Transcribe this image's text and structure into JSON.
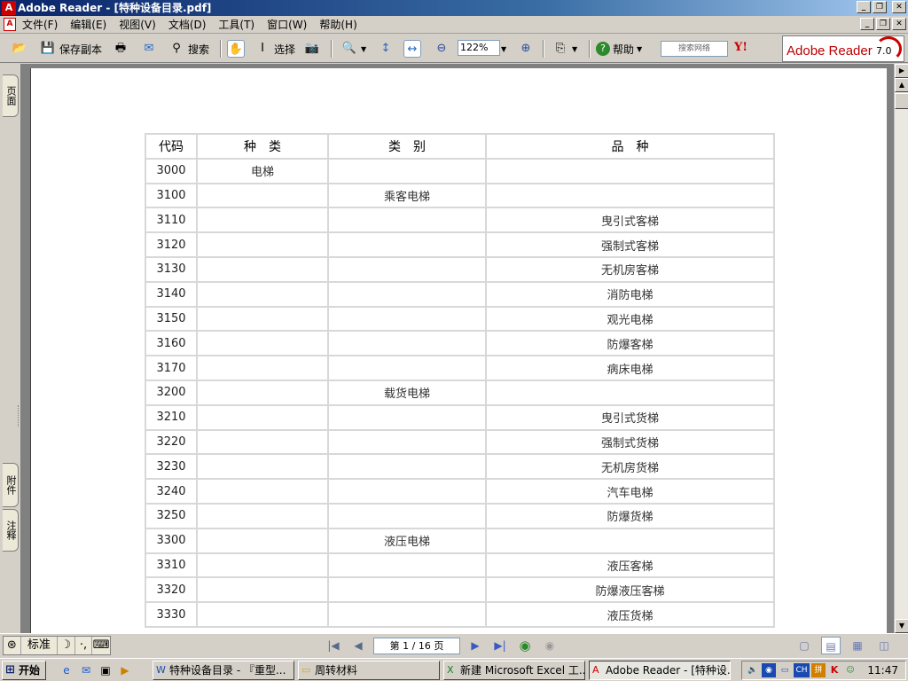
{
  "window": {
    "title": "Adobe Reader - [特种设备目录.pdf]"
  },
  "menu": {
    "items": [
      "文件(F)",
      "编辑(E)",
      "视图(V)",
      "文档(D)",
      "工具(T)",
      "窗口(W)",
      "帮助(H)"
    ]
  },
  "toolbar": {
    "save_copy": "保存副本",
    "search": "搜索",
    "select": "选择",
    "zoom": "122%",
    "help": "帮助",
    "search_web_placeholder": "搜索网络",
    "yahoo": "Y!",
    "brand": "Adobe Reader",
    "brand_version": "7.0"
  },
  "nav_tabs": {
    "pages": "页面",
    "attachments": "附件",
    "comments": "注释"
  },
  "table": {
    "headers": [
      "代码",
      "种　类",
      "类　别",
      "品　种"
    ],
    "rows": [
      [
        "3000",
        "电梯",
        "",
        ""
      ],
      [
        "3100",
        "",
        "乘客电梯",
        ""
      ],
      [
        "3110",
        "",
        "",
        "曳引式客梯"
      ],
      [
        "3120",
        "",
        "",
        "强制式客梯"
      ],
      [
        "3130",
        "",
        "",
        "无机房客梯"
      ],
      [
        "3140",
        "",
        "",
        "消防电梯"
      ],
      [
        "3150",
        "",
        "",
        "观光电梯"
      ],
      [
        "3160",
        "",
        "",
        "防爆客梯"
      ],
      [
        "3170",
        "",
        "",
        "病床电梯"
      ],
      [
        "3200",
        "",
        "载货电梯",
        ""
      ],
      [
        "3210",
        "",
        "",
        "曳引式货梯"
      ],
      [
        "3220",
        "",
        "",
        "强制式货梯"
      ],
      [
        "3230",
        "",
        "",
        "无机房货梯"
      ],
      [
        "3240",
        "",
        "",
        "汽车电梯"
      ],
      [
        "3250",
        "",
        "",
        "防爆货梯"
      ],
      [
        "3300",
        "",
        "液压电梯",
        ""
      ],
      [
        "3310",
        "",
        "",
        "液压客梯"
      ],
      [
        "3320",
        "",
        "",
        "防爆液压客梯"
      ],
      [
        "3330",
        "",
        "",
        "液压货梯"
      ]
    ]
  },
  "status": {
    "ime_mode": "标准",
    "page_indicator": "第 1 / 16 页"
  },
  "taskbar": {
    "start": "开始",
    "tasks": [
      "特种设备目录 - 『重型...",
      "周转材料",
      "新建 Microsoft Excel 工...",
      "Adobe Reader - [特种设..."
    ],
    "tray_lang": "CH",
    "clock": "11:47"
  }
}
